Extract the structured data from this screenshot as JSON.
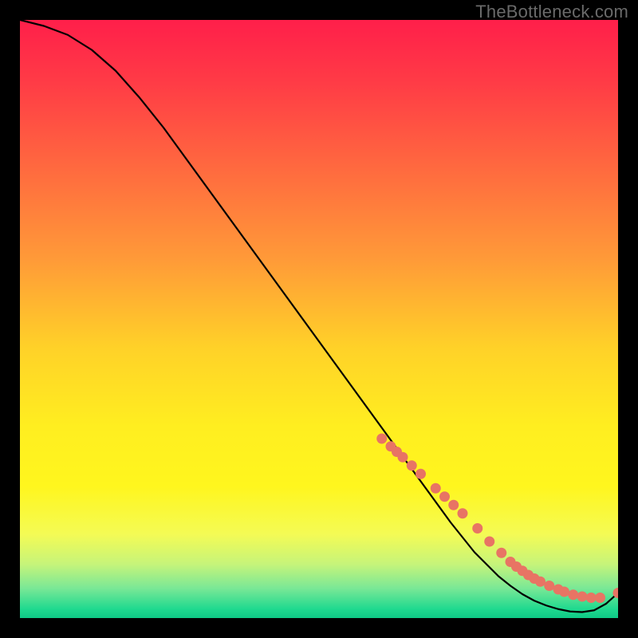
{
  "watermark": "TheBottleneck.com",
  "chart_data": {
    "type": "line",
    "title": "",
    "xlabel": "",
    "ylabel": "",
    "xlim": [
      0,
      100
    ],
    "ylim": [
      0,
      100
    ],
    "grid": false,
    "series": [
      {
        "name": "curve",
        "x": [
          0,
          4,
          8,
          12,
          16,
          20,
          24,
          28,
          32,
          36,
          40,
          44,
          48,
          52,
          56,
          60,
          64,
          68,
          72,
          76,
          80,
          82,
          84,
          86,
          88,
          90,
          92,
          94,
          96,
          98,
          100
        ],
        "y": [
          100,
          99,
          97.5,
          95,
          91.5,
          87,
          82,
          76.5,
          71,
          65.5,
          60,
          54.5,
          49,
          43.5,
          38,
          32.5,
          27,
          21.5,
          16,
          11,
          7,
          5.4,
          4,
          2.9,
          2.1,
          1.5,
          1.1,
          1,
          1.3,
          2.4,
          4.2
        ],
        "color": "#000000"
      }
    ],
    "markers": {
      "name": "highlight-dots",
      "color": "#e87464",
      "x": [
        60.5,
        62,
        63,
        64,
        65.5,
        67,
        69.5,
        71,
        72.5,
        74,
        76.5,
        78.5,
        80.5,
        82,
        83,
        84,
        85,
        86,
        87,
        88.5,
        90,
        91,
        92.5,
        94,
        95.5,
        97,
        100
      ],
      "y": [
        30,
        28.7,
        27.8,
        26.9,
        25.5,
        24.1,
        21.7,
        20.3,
        18.9,
        17.5,
        15,
        12.8,
        10.9,
        9.4,
        8.6,
        7.9,
        7.2,
        6.6,
        6.1,
        5.4,
        4.8,
        4.4,
        3.9,
        3.6,
        3.4,
        3.4,
        4.2
      ]
    },
    "background_gradient": {
      "stops": [
        {
          "offset": 0.0,
          "color": "#ff1f4a"
        },
        {
          "offset": 0.1,
          "color": "#ff3a46"
        },
        {
          "offset": 0.25,
          "color": "#ff6a3f"
        },
        {
          "offset": 0.4,
          "color": "#ff9a38"
        },
        {
          "offset": 0.55,
          "color": "#ffd228"
        },
        {
          "offset": 0.68,
          "color": "#ffee20"
        },
        {
          "offset": 0.78,
          "color": "#fff61e"
        },
        {
          "offset": 0.86,
          "color": "#f4fb55"
        },
        {
          "offset": 0.91,
          "color": "#c6f47a"
        },
        {
          "offset": 0.95,
          "color": "#7ae896"
        },
        {
          "offset": 0.985,
          "color": "#1fd98f"
        },
        {
          "offset": 1.0,
          "color": "#0fc986"
        }
      ]
    }
  }
}
